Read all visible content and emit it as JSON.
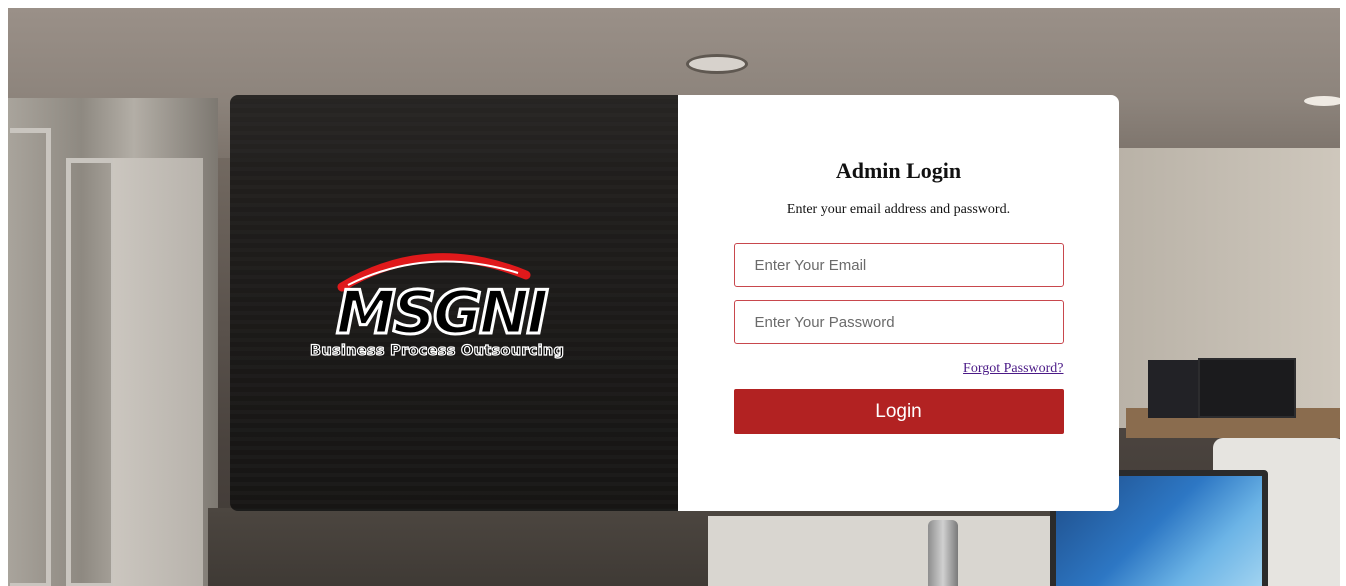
{
  "login": {
    "title": "Admin Login",
    "subtitle": "Enter your email address and password.",
    "email_placeholder": "Enter Your Email",
    "email_value": "",
    "password_placeholder": "Enter Your Password",
    "password_value": "",
    "forgot_label": "Forgot Password?",
    "button_label": "Login"
  },
  "logo": {
    "name": "MSGNI",
    "tagline": "Business Process Outsourcing"
  },
  "colors": {
    "accent": "#b22222",
    "input_border": "#c8474d",
    "link": "#4b1a87",
    "panel_dark": "#0a0a0a"
  }
}
